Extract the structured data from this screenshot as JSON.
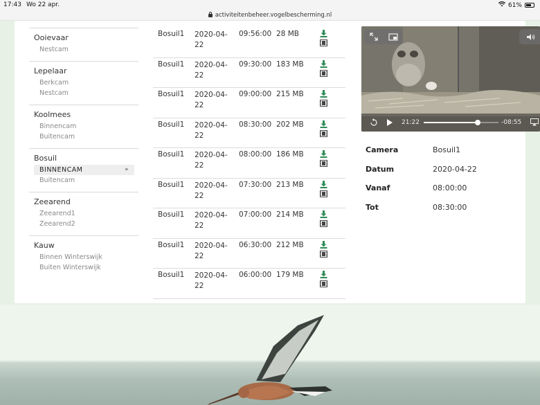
{
  "status_bar": {
    "time": "17:43",
    "date": "Wo 22 apr.",
    "battery": "61%"
  },
  "url_bar": {
    "url": "activiteitenbeheer.vogelbescherming.nl"
  },
  "nav": {
    "groups": [
      {
        "title": "Ooievaar",
        "cams": [
          "Nestcam"
        ]
      },
      {
        "title": "Lepelaar",
        "cams": [
          "Berkcam",
          "Nestcam"
        ]
      },
      {
        "title": "Koolmees",
        "cams": [
          "Binnencam",
          "Buitencam"
        ]
      },
      {
        "title": "Bosuil",
        "cams": [
          "BINNENCAM",
          "Buitencam"
        ],
        "active": "BINNENCAM"
      },
      {
        "title": "Zeearend",
        "cams": [
          "Zeearend1",
          "Zeearend2"
        ]
      },
      {
        "title": "Kauw",
        "cams": [
          "Binnen Winterswijk",
          "Buiten Winterswijk"
        ]
      }
    ],
    "active_arrow": "»"
  },
  "recordings": [
    {
      "camera": "Bosuil1",
      "date": "2020-04-22",
      "time": "09:56:00",
      "size": "28 MB"
    },
    {
      "camera": "Bosuil1",
      "date": "2020-04-22",
      "time": "09:30:00",
      "size": "183 MB"
    },
    {
      "camera": "Bosuil1",
      "date": "2020-04-22",
      "time": "09:00:00",
      "size": "215 MB"
    },
    {
      "camera": "Bosuil1",
      "date": "2020-04-22",
      "time": "08:30:00",
      "size": "202 MB"
    },
    {
      "camera": "Bosuil1",
      "date": "2020-04-22",
      "time": "08:00:00",
      "size": "186 MB"
    },
    {
      "camera": "Bosuil1",
      "date": "2020-04-22",
      "time": "07:30:00",
      "size": "213 MB"
    },
    {
      "camera": "Bosuil1",
      "date": "2020-04-22",
      "time": "07:00:00",
      "size": "214 MB"
    },
    {
      "camera": "Bosuil1",
      "date": "2020-04-22",
      "time": "06:30:00",
      "size": "212 MB"
    },
    {
      "camera": "Bosuil1",
      "date": "2020-04-22",
      "time": "06:00:00",
      "size": "179 MB"
    }
  ],
  "player": {
    "current_time": "21:22",
    "remaining_time": "-08:55",
    "progress": 0.72
  },
  "details": {
    "camera_label": "Camera",
    "camera_value": "Bosuil1",
    "date_label": "Datum",
    "date_value": "2020-04-22",
    "from_label": "Vanaf",
    "from_value": "08:00:00",
    "to_label": "Tot",
    "to_value": "08:30:00"
  },
  "colors": {
    "download_icon": "#2e8b57",
    "film_icon": "#444444",
    "active_cam_bg": "#eeeeee",
    "page_bg": "#e8f1e6"
  }
}
